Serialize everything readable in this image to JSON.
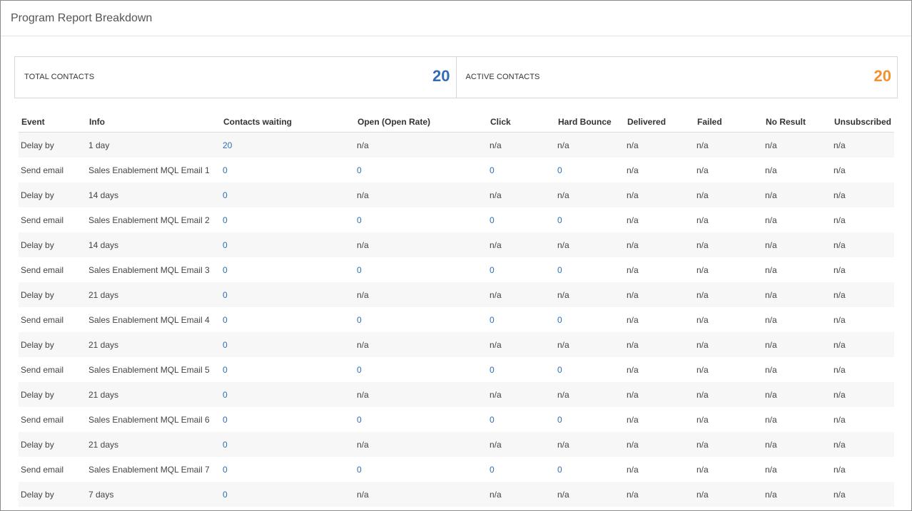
{
  "page": {
    "title": "Program Report Breakdown"
  },
  "stats": {
    "total_label": "TOTAL CONTACTS",
    "total_value": "20",
    "total_color": "#2f6eb5",
    "active_label": "ACTIVE CONTACTS",
    "active_value": "20",
    "active_color": "#f0922e"
  },
  "table": {
    "columns": [
      "Event",
      "Info",
      "Contacts waiting",
      "Open (Open Rate)",
      "Click",
      "Hard Bounce",
      "Delivered",
      "Failed",
      "No Result",
      "Unsubscribed"
    ],
    "rows": [
      [
        "Delay by",
        "1 day",
        "20",
        "n/a",
        "n/a",
        "n/a",
        "n/a",
        "n/a",
        "n/a",
        "n/a"
      ],
      [
        "Send email",
        "Sales Enablement MQL Email 1",
        "0",
        "0",
        "0",
        "0",
        "n/a",
        "n/a",
        "n/a",
        "n/a"
      ],
      [
        "Delay by",
        "14 days",
        "0",
        "n/a",
        "n/a",
        "n/a",
        "n/a",
        "n/a",
        "n/a",
        "n/a"
      ],
      [
        "Send email",
        "Sales Enablement MQL Email 2",
        "0",
        "0",
        "0",
        "0",
        "n/a",
        "n/a",
        "n/a",
        "n/a"
      ],
      [
        "Delay by",
        "14 days",
        "0",
        "n/a",
        "n/a",
        "n/a",
        "n/a",
        "n/a",
        "n/a",
        "n/a"
      ],
      [
        "Send email",
        "Sales Enablement MQL Email 3",
        "0",
        "0",
        "0",
        "0",
        "n/a",
        "n/a",
        "n/a",
        "n/a"
      ],
      [
        "Delay by",
        "21 days",
        "0",
        "n/a",
        "n/a",
        "n/a",
        "n/a",
        "n/a",
        "n/a",
        "n/a"
      ],
      [
        "Send email",
        "Sales Enablement MQL Email 4",
        "0",
        "0",
        "0",
        "0",
        "n/a",
        "n/a",
        "n/a",
        "n/a"
      ],
      [
        "Delay by",
        "21 days",
        "0",
        "n/a",
        "n/a",
        "n/a",
        "n/a",
        "n/a",
        "n/a",
        "n/a"
      ],
      [
        "Send email",
        "Sales Enablement MQL Email 5",
        "0",
        "0",
        "0",
        "0",
        "n/a",
        "n/a",
        "n/a",
        "n/a"
      ],
      [
        "Delay by",
        "21 days",
        "0",
        "n/a",
        "n/a",
        "n/a",
        "n/a",
        "n/a",
        "n/a",
        "n/a"
      ],
      [
        "Send email",
        "Sales Enablement MQL Email 6",
        "0",
        "0",
        "0",
        "0",
        "n/a",
        "n/a",
        "n/a",
        "n/a"
      ],
      [
        "Delay by",
        "21 days",
        "0",
        "n/a",
        "n/a",
        "n/a",
        "n/a",
        "n/a",
        "n/a",
        "n/a"
      ],
      [
        "Send email",
        "Sales Enablement MQL Email 7",
        "0",
        "0",
        "0",
        "0",
        "n/a",
        "n/a",
        "n/a",
        "n/a"
      ],
      [
        "Delay by",
        "7 days",
        "0",
        "n/a",
        "n/a",
        "n/a",
        "n/a",
        "n/a",
        "n/a",
        "n/a"
      ]
    ]
  }
}
